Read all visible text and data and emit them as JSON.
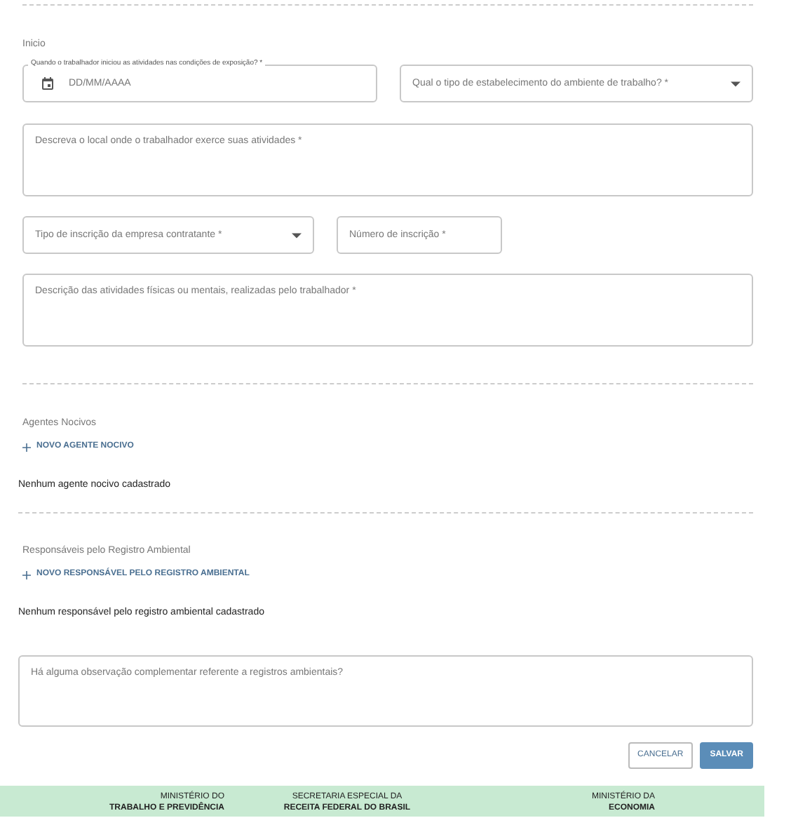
{
  "section_title": "Inicio",
  "fields": [
    {
      "kind": "date",
      "label": "Quando o trabalhador iniciou as atividades nas condições de exposição? *",
      "placeholder": "DD/MM/AAAA"
    },
    {
      "kind": "select",
      "placeholder": "Qual o tipo de estabelecimento do ambiente de trabalho? *"
    },
    {
      "kind": "textarea",
      "placeholder": "Descreva o local onde o trabalhador exerce suas atividades *"
    },
    {
      "kind": "select",
      "placeholder": "Tipo de inscrição da empresa contratante *"
    },
    {
      "kind": "text",
      "placeholder": "Número de inscrição *"
    },
    {
      "kind": "textarea",
      "placeholder": "Descrição das atividades físicas ou mentais, realizadas pelo trabalhador *"
    }
  ],
  "groups": [
    {
      "title": "Agentes Nocivos",
      "add_button": "NOVO AGENTE NOCIVO",
      "empty_text": "Nenhum agente nocivo cadastrado"
    },
    {
      "title": "Responsáveis pelo Registro Ambiental",
      "add_button": "NOVO RESPONSÁVEL PELO REGISTRO AMBIENTAL",
      "empty_text": "Nenhum responsável pelo registro ambiental cadastrado"
    }
  ],
  "observation": {
    "placeholder": "Há alguma observação complementar referente a registros ambientais?"
  },
  "buttons": [
    {
      "kind": "outline",
      "label": "CANCELAR"
    },
    {
      "kind": "primary",
      "label": "SALVAR"
    }
  ],
  "footer": [
    {
      "line1": "MINISTÉRIO DO",
      "line2": "TRABALHO E PREVIDÊNCIA"
    },
    {
      "line1": "SECRETARIA ESPECIAL DA",
      "line2": "RECEITA FEDERAL DO BRASIL"
    },
    {
      "line1": "MINISTÉRIO DA",
      "line2": "ECONOMIA"
    }
  ]
}
